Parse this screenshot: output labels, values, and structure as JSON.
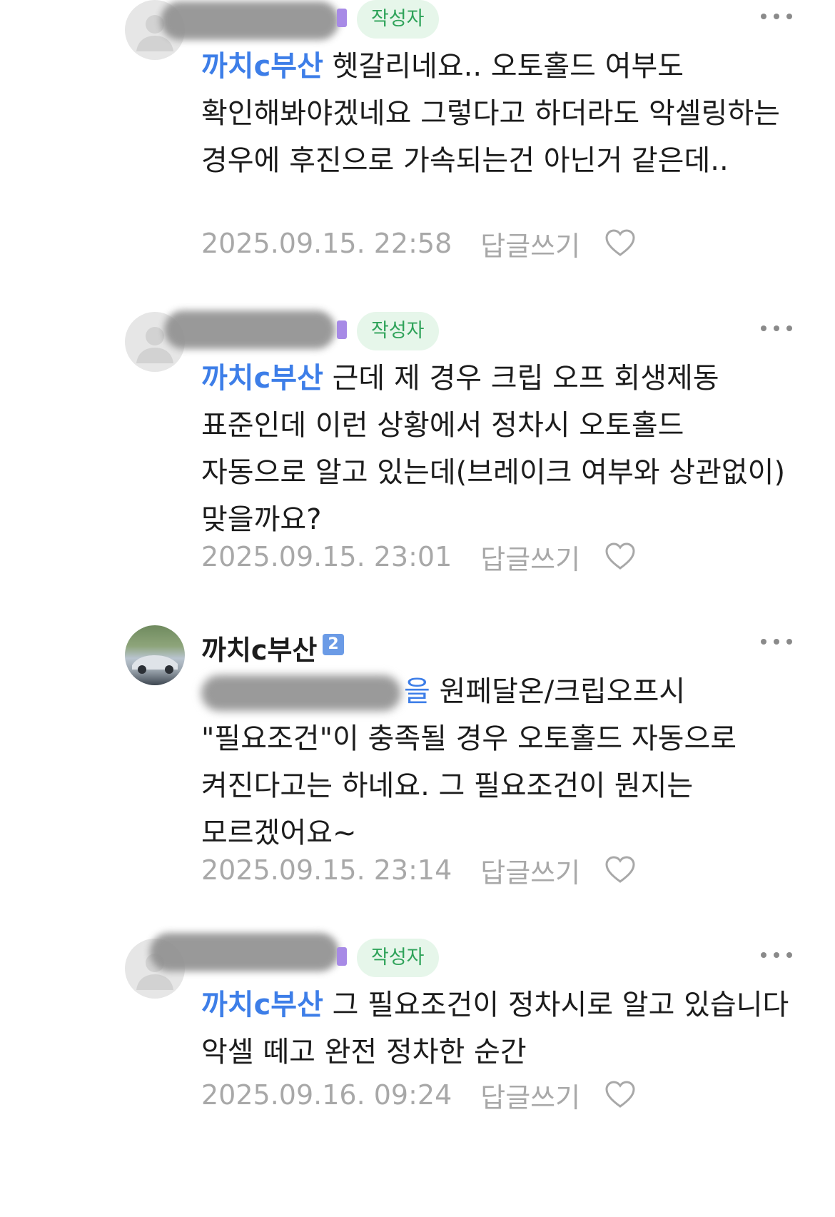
{
  "comments": [
    {
      "author_badge": "작성자",
      "mention": "까치c부산",
      "text": " 헷갈리네요.. 오토홀드 여부도 확인해봐야겠네요 그렇다고 하더라도 악셀링하는 경우에 후진으로 가속되는건 아닌거 같은데..",
      "date": "2025.09.15. 22:58",
      "reply_label": "답글쓰기"
    },
    {
      "author_badge": "작성자",
      "mention": "까치c부산",
      "text": " 근데 제 경우 크립 오프 회생제동 표준인데 이런 상황에서 정차시 오토홀드 자동으로 알고 있는데(브레이크 여부와 상관없이) 맞을까요?",
      "date": "2025.09.15. 23:01",
      "reply_label": "답글쓰기"
    },
    {
      "author_name": "까치c부산",
      "level": "2",
      "mention_tail": "을",
      "text": " 원페달온/크립오프시 \"필요조건\"이 충족될 경우 오토홀드 자동으로 켜진다고는 하네요. 그 필요조건이 뭔지는 모르겠어요~",
      "date": "2025.09.15. 23:14",
      "reply_label": "답글쓰기"
    },
    {
      "author_badge": "작성자",
      "mention": "까치c부산",
      "text": " 그 필요조건이 정차시로 알고 있습니다 악셀 떼고 완전 정차한 순간",
      "date": "2025.09.16. 09:24",
      "reply_label": "답글쓰기"
    }
  ],
  "icons": {
    "more": "more-horizontal-icon",
    "like": "heart-outline-icon",
    "avatar": "default-profile-icon"
  },
  "colors": {
    "mention": "#3d7ee8",
    "author_badge_bg": "#e6f6ea",
    "author_badge_text": "#2fa35a",
    "meta_text": "#a8a8a8"
  }
}
